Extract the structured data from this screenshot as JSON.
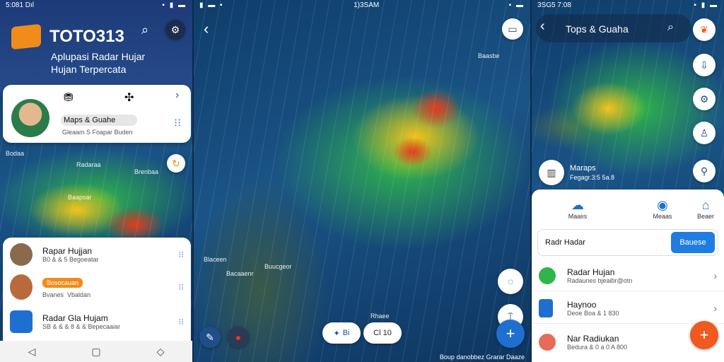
{
  "status": {
    "left_time": "5:081 Dıl",
    "center_time": "1)3SAM",
    "right_time": "3SG5 7:08"
  },
  "panel1": {
    "brand": "TOTO313",
    "tagline_line1": "Aplupasi Radar Hujar",
    "tagline_line2": "Hujan Terpercata",
    "profile_card": {
      "title": "Maps & Guahe",
      "subtitle": "Gleaam  S Foapar Buden"
    },
    "list": [
      {
        "title": "Rapar Hujjan",
        "subtitle": "B0 & & 5 Begoeatar"
      },
      {
        "title": "",
        "badge": "Bosocauan",
        "sub_a": "Bvanes",
        "sub_b": "Vbaldan"
      },
      {
        "title": "Radar Gla Hujam",
        "subtitle": "SB & & & 8 & & Bepecaaiar"
      }
    ]
  },
  "panel2": {
    "pill_left": "Bi",
    "pill_right": "Cl 10",
    "map_credit": "Boup danobbez Grarar Daaze"
  },
  "panel3": {
    "title": "Tops & Guaha",
    "location_label": "Maraps",
    "location_sub": "Fegagr.3:5 5a.8",
    "tabs": [
      {
        "label": "Maaiıs"
      },
      {
        "label": "Meaas"
      },
      {
        "label": "Beaer"
      }
    ],
    "search_text": "Radr Hadar",
    "search_button": "Bauese",
    "list": [
      {
        "title": "Radar Hujan",
        "subtitle": "Radaunes bjeaibr@otn"
      },
      {
        "title": "Haynoo",
        "subtitle": "Deoe Boa & 1 830"
      },
      {
        "title": "Nar Radiukan",
        "subtitle": "Bedura & 0 a 0 A 800"
      }
    ]
  },
  "colors": {
    "brand_orange": "#f08c1a",
    "blue_button": "#1f7de0",
    "fab_orange": "#f05a1e",
    "green_dot": "#2fb54a"
  }
}
